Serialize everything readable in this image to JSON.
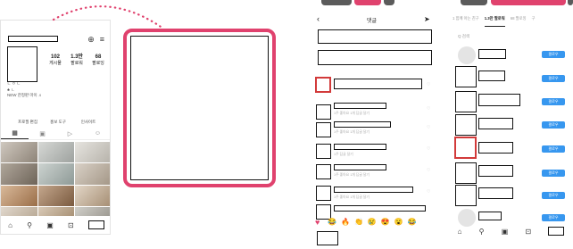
{
  "colors": {
    "accent_pink": "#e0426e",
    "follow_blue": "#3797ef",
    "red_highlight": "#d23a3a"
  },
  "profile": {
    "stats": [
      {
        "value": "102",
        "label": "게시물"
      },
      {
        "value": "1.3만",
        "label": "팔로워"
      },
      {
        "value": "68",
        "label": "팔로잉"
      }
    ],
    "bio_line": "ㄴ ㅇ ㄴ",
    "bio_tags": "♣ ㄴ",
    "bio_link": "NEW 한정판 마이 ♬",
    "buttons": [
      "프로필 편집",
      "홍보 도구",
      "인사이트"
    ],
    "tab_icons": [
      "grid-icon",
      "reels-icon",
      "video-icon",
      "tagged-icon"
    ],
    "nav_icons": [
      "home-icon",
      "search-icon",
      "shop-icon",
      "bag-icon",
      "profile-icon"
    ]
  },
  "comments": {
    "title": "댓글",
    "back_icon": "chevron-left-icon",
    "send_icon": "send-icon",
    "rows": [
      {
        "meta": "1주 좋아요 1개 답글 달기"
      },
      {
        "meta": "1주 좋아요 1개 답글 달기"
      },
      {
        "meta": "1주 답글 달기"
      },
      {
        "meta": "1주 좋아요 1개 답글 달기"
      },
      {
        "meta": "1주 좋아요 1개 답글 달기"
      }
    ],
    "emojis": [
      "😂",
      "🔥",
      "👏",
      "😢",
      "😍",
      "😮",
      "😂"
    ]
  },
  "followers": {
    "tabs": [
      "1 함께 아는 친구",
      "1.3만 팔로워",
      "68 팔로잉",
      "구"
    ],
    "search_placeholder": "Q 검색",
    "follow_label": "팔로우",
    "nav_icons": [
      "home-icon",
      "search-icon",
      "shop-icon",
      "bag-icon",
      "profile-icon"
    ]
  }
}
